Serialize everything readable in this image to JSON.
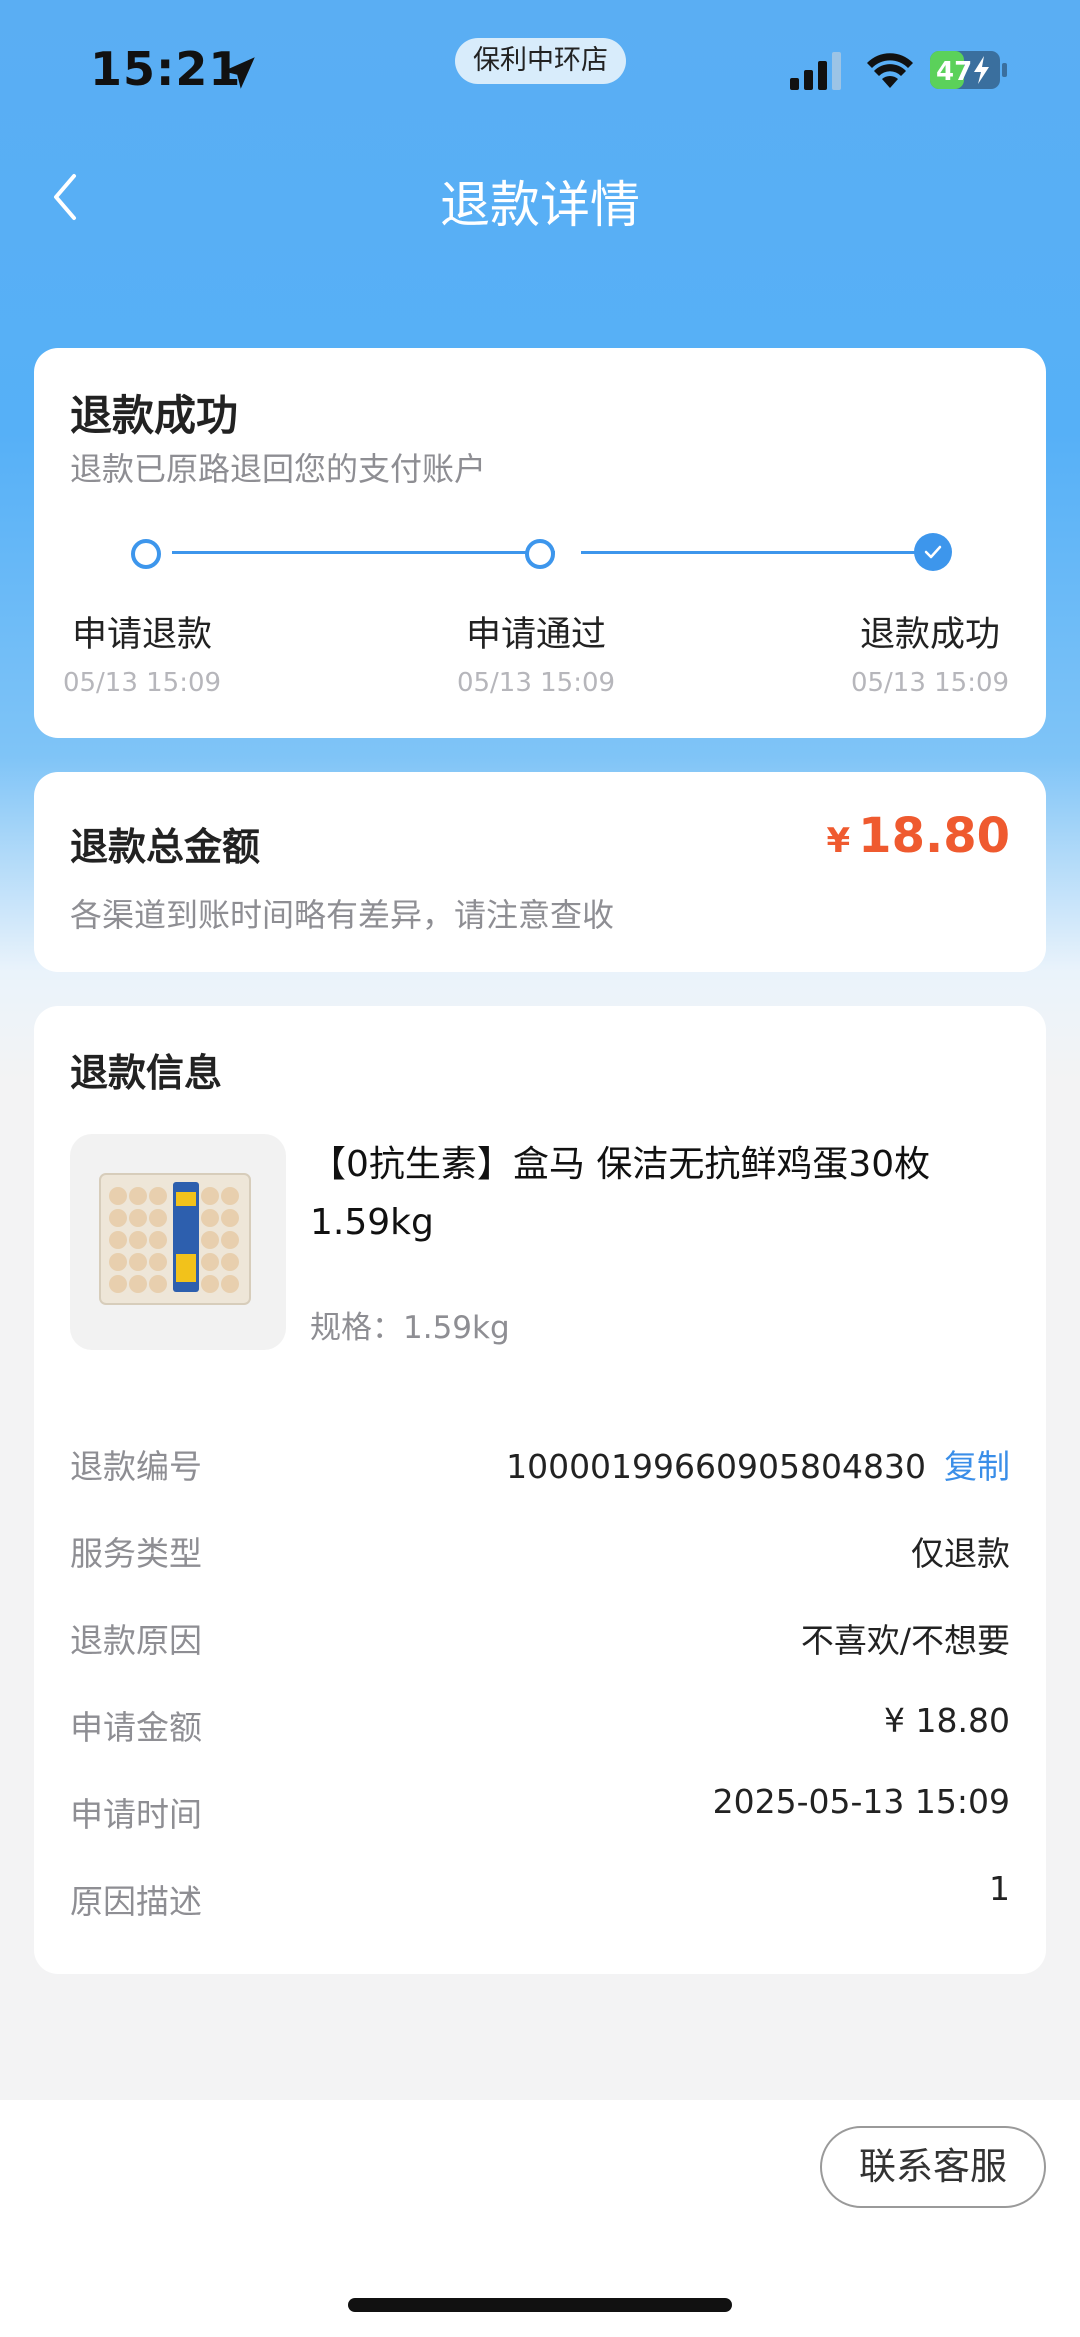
{
  "status_bar": {
    "time": "15:21",
    "store": "保利中环店",
    "battery": "47"
  },
  "nav": {
    "title": "退款详情"
  },
  "status_card": {
    "title": "退款成功",
    "subtitle": "退款已原路退回您的支付账户",
    "steps": [
      {
        "label": "申请退款",
        "time": "05/13 15:09"
      },
      {
        "label": "申请通过",
        "time": "05/13 15:09"
      },
      {
        "label": "退款成功",
        "time": "05/13 15:09"
      }
    ]
  },
  "amount_card": {
    "label": "退款总金额",
    "currency": "¥",
    "amount": "18.80",
    "note": "各渠道到账时间略有差异，请注意查收"
  },
  "info_card": {
    "title": "退款信息",
    "product_name": "【0抗生素】盒马 保洁无抗鲜鸡蛋30枚 1.59kg",
    "product_spec": "规格：1.59kg",
    "rows": [
      {
        "label": "退款编号",
        "value": "10000199660905804830",
        "action": "复制"
      },
      {
        "label": "服务类型",
        "value": "仅退款"
      },
      {
        "label": "退款原因",
        "value": "不喜欢/不想要"
      },
      {
        "label": "申请金额",
        "value": "¥ 18.80"
      },
      {
        "label": "申请时间",
        "value": "2025-05-13 15:09"
      },
      {
        "label": "原因描述",
        "value": "1"
      }
    ]
  },
  "bottom": {
    "contact_button": "联系客服"
  },
  "colors": {
    "accent": "#3d96ec",
    "price": "#ef5a2f",
    "header_bg": "#56b0f7"
  }
}
